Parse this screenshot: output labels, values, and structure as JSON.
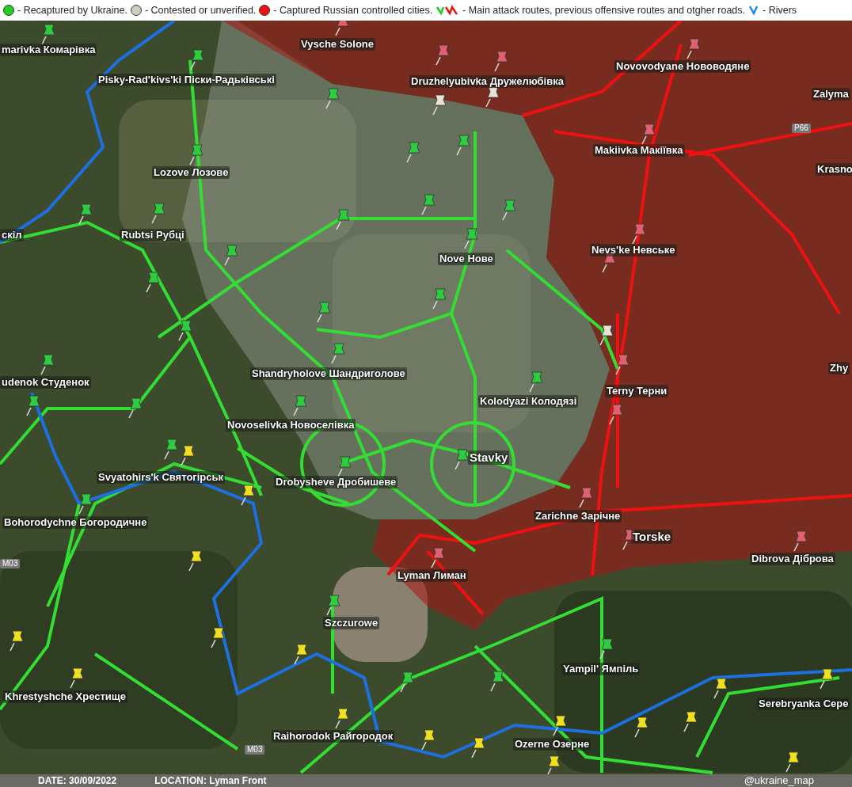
{
  "legend": [
    {
      "kind": "dot",
      "color": "#22cc22",
      "text": "- Recaptured by Ukraine."
    },
    {
      "kind": "dot",
      "color": "#d0ccc0",
      "text": "- Contested or unverified."
    },
    {
      "kind": "dot",
      "color": "#ee1111",
      "text": "- Captured Russian controlled cities."
    },
    {
      "kind": "routes",
      "text": "- Main attack routes, previous offensive routes and otgher roads."
    },
    {
      "kind": "river",
      "text": "- Rivers"
    }
  ],
  "map": {
    "places": [
      {
        "kind": "village",
        "label": "Vysche Solone"
      },
      {
        "kind": "village",
        "label": "marivka Комарівка"
      },
      {
        "kind": "village",
        "label": "Pisky-Rad'kivs'ki Піски-Радьківські"
      },
      {
        "kind": "village",
        "label": "Druzhelyubivka Дружелюбівка"
      },
      {
        "kind": "village",
        "label": "Novovodyane Нововодяне"
      },
      {
        "kind": "village",
        "label": "Zalyma"
      },
      {
        "kind": "road",
        "label": "P66"
      },
      {
        "kind": "village",
        "label": "Makiivka Макіївка"
      },
      {
        "kind": "village",
        "label": "Krasno"
      },
      {
        "kind": "village",
        "label": "Lozove Лозове"
      },
      {
        "kind": "village",
        "label": "Rubtsi Рубці"
      },
      {
        "kind": "village",
        "label": "скіл"
      },
      {
        "kind": "village",
        "label": "Nove Нове"
      },
      {
        "kind": "village",
        "label": "Nevs'ke Невське"
      },
      {
        "kind": "village",
        "label": "Shandryholove Шандриголове"
      },
      {
        "kind": "village",
        "label": "udenok Студенок"
      },
      {
        "kind": "village",
        "label": "Terny Терни"
      },
      {
        "kind": "village",
        "label": "Kolodyazi Колодязі"
      },
      {
        "kind": "village",
        "label": "Zhy"
      },
      {
        "kind": "village",
        "label": "Novoselivka Новоселівка"
      },
      {
        "kind": "town",
        "label": "Stavky"
      },
      {
        "kind": "village",
        "label": "Svyatohirs'k Святогірськ"
      },
      {
        "kind": "village",
        "label": "Drobysheve Дробишеве"
      },
      {
        "kind": "village",
        "label": "Bohorodychne Богородичне"
      },
      {
        "kind": "village",
        "label": "Zarichne Зарічне"
      },
      {
        "kind": "town",
        "label": "Torske"
      },
      {
        "kind": "road",
        "label": "M03"
      },
      {
        "kind": "village",
        "label": "Dibrova Діброва"
      },
      {
        "kind": "village",
        "label": "Lyman Лиман"
      },
      {
        "kind": "village",
        "label": "Szczurowe"
      },
      {
        "kind": "village",
        "label": "Yampil' Ямпіль"
      },
      {
        "kind": "village",
        "label": "Khrestyshche Хрестище"
      },
      {
        "kind": "village",
        "label": "Raihorodok Райгородок"
      },
      {
        "kind": "road",
        "label": "M03"
      },
      {
        "kind": "village",
        "label": "Ozerne Озерне"
      },
      {
        "kind": "village",
        "label": "Serebryanka Сере"
      }
    ],
    "pins": [
      {
        "color": "#2ecc40"
      },
      {
        "color": "#2ecc40"
      },
      {
        "color": "#2ecc40"
      },
      {
        "color": "#2ecc40"
      },
      {
        "color": "#2ecc40"
      },
      {
        "color": "#2ecc40"
      },
      {
        "color": "#2ecc40"
      },
      {
        "color": "#2ecc40"
      },
      {
        "color": "#2ecc40"
      },
      {
        "color": "#2ecc40"
      },
      {
        "color": "#2ecc40"
      },
      {
        "color": "#2ecc40"
      },
      {
        "color": "#2ecc40"
      },
      {
        "color": "#2ecc40"
      },
      {
        "color": "#2ecc40"
      },
      {
        "color": "#2ecc40"
      },
      {
        "color": "#2ecc40"
      },
      {
        "color": "#2ecc40"
      },
      {
        "color": "#2ecc40"
      },
      {
        "color": "#2ecc40"
      },
      {
        "color": "#2ecc40"
      },
      {
        "color": "#2ecc40"
      },
      {
        "color": "#2ecc40"
      },
      {
        "color": "#2ecc40"
      },
      {
        "color": "#2ecc40"
      },
      {
        "color": "#2ecc40"
      },
      {
        "color": "#2ecc40"
      },
      {
        "color": "#2ecc40"
      },
      {
        "color": "#2ecc40"
      },
      {
        "color": "#2ecc40"
      },
      {
        "color": "#2ecc40"
      },
      {
        "color": "#e8e4d8"
      },
      {
        "color": "#e8e4d8"
      },
      {
        "color": "#e8e4d8"
      },
      {
        "color": "#e06070"
      },
      {
        "color": "#e06070"
      },
      {
        "color": "#e06070"
      },
      {
        "color": "#e06070"
      },
      {
        "color": "#e06070"
      },
      {
        "color": "#e06070"
      },
      {
        "color": "#e06070"
      },
      {
        "color": "#e06070"
      },
      {
        "color": "#e06070"
      },
      {
        "color": "#e06070"
      },
      {
        "color": "#e06070"
      },
      {
        "color": "#e06070"
      },
      {
        "color": "#e06070"
      },
      {
        "color": "#f0e020"
      },
      {
        "color": "#f0e020"
      },
      {
        "color": "#f0e020"
      },
      {
        "color": "#f0e020"
      },
      {
        "color": "#f0e020"
      },
      {
        "color": "#f0e020"
      },
      {
        "color": "#f0e020"
      },
      {
        "color": "#f0e020"
      },
      {
        "color": "#f0e020"
      },
      {
        "color": "#f0e020"
      },
      {
        "color": "#f0e020"
      },
      {
        "color": "#f0e020"
      },
      {
        "color": "#f0e020"
      },
      {
        "color": "#f0e020"
      },
      {
        "color": "#f0e020"
      },
      {
        "color": "#f0e020"
      },
      {
        "color": "#f0e020"
      }
    ]
  },
  "footer": {
    "date": "DATE: 30/09/2022",
    "location": "LOCATION: Lyman Front",
    "credit": "@ukraine_map"
  }
}
